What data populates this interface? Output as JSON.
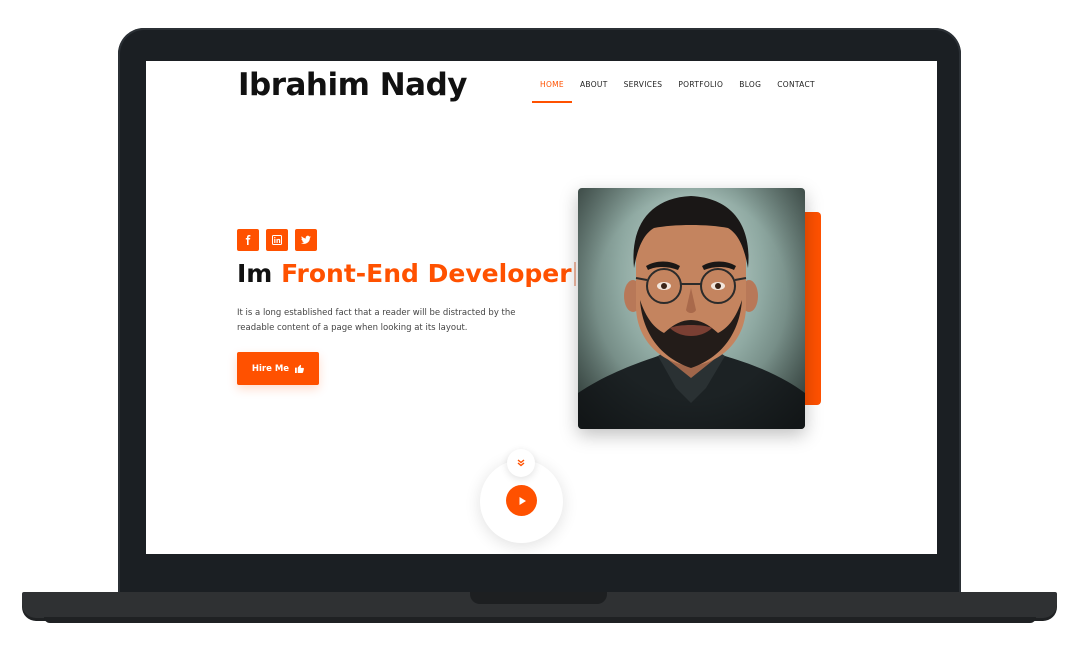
{
  "brand": {
    "name": "Ibrahim Nady"
  },
  "nav": {
    "items": [
      "HOME",
      "ABOUT",
      "SERVICES",
      "PORTFOLIO",
      "BLOG",
      "CONTACT"
    ],
    "active": "HOME"
  },
  "hero": {
    "socials": [
      "facebook-icon",
      "linkedin-icon",
      "twitter-icon"
    ],
    "headline_prefix": "Im",
    "headline_accent": "Front-End Developer",
    "description": "It is a long established fact that a reader will be distracted by the readable content of a page when looking at its layout.",
    "cta_label": "Hire Me"
  },
  "colors": {
    "accent": "#ff5100",
    "text": "#111111",
    "frame": "#1b1f23"
  }
}
